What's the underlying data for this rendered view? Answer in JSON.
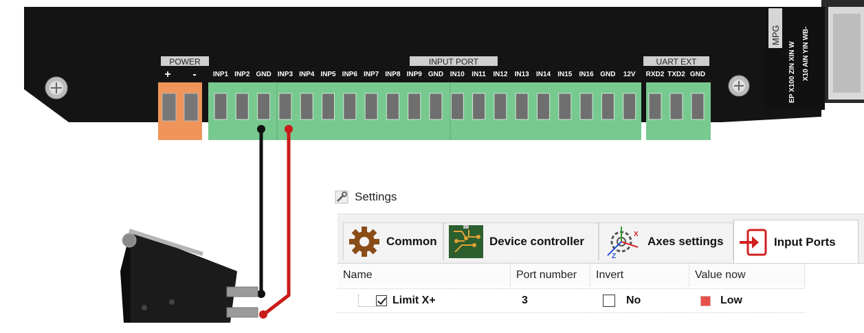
{
  "board": {
    "power_label": "POWER",
    "power_plus": "+",
    "power_minus": "-",
    "input_port_label": "INPUT PORT",
    "uart_label": "UART EXT",
    "mpg_label": "MPG",
    "mpg_pins_1": "EP X100 ZIN XIN W",
    "mpg_pins_2": "X10 AIN YIN WB-",
    "pins": [
      "INP1",
      "INP2",
      "GND",
      "INP3",
      "INP4",
      "INP5",
      "INP6",
      "INP7",
      "INP8",
      "INP9",
      "GND",
      "IN10",
      "IN11",
      "IN12",
      "IN13",
      "IN14",
      "IN15",
      "IN16",
      "GND",
      "12V"
    ],
    "uart_pins": [
      "RXD2",
      "TXD2",
      "GND"
    ],
    "colors": {
      "board": "#141414",
      "terminal_green": "#78c98f",
      "terminal_orange": "#f0955a",
      "wire_black": "#111111",
      "wire_red": "#c91a1a"
    }
  },
  "settings": {
    "title": "Settings",
    "tabs": [
      {
        "label": "Common",
        "icon": "gear-icon"
      },
      {
        "label": "Device controller",
        "icon": "circuit-board-icon"
      },
      {
        "label": "Axes settings",
        "icon": "axes-gear-icon"
      },
      {
        "label": "Input Ports",
        "icon": "input-arrow-icon",
        "active": true
      }
    ],
    "columns": [
      "Name",
      "Port number",
      "Invert",
      "Value now"
    ],
    "rows": [
      {
        "name": "Limit X+",
        "checked": true,
        "port": "3",
        "invert": "No",
        "value": "Low",
        "value_color": "#e8504a"
      }
    ]
  }
}
